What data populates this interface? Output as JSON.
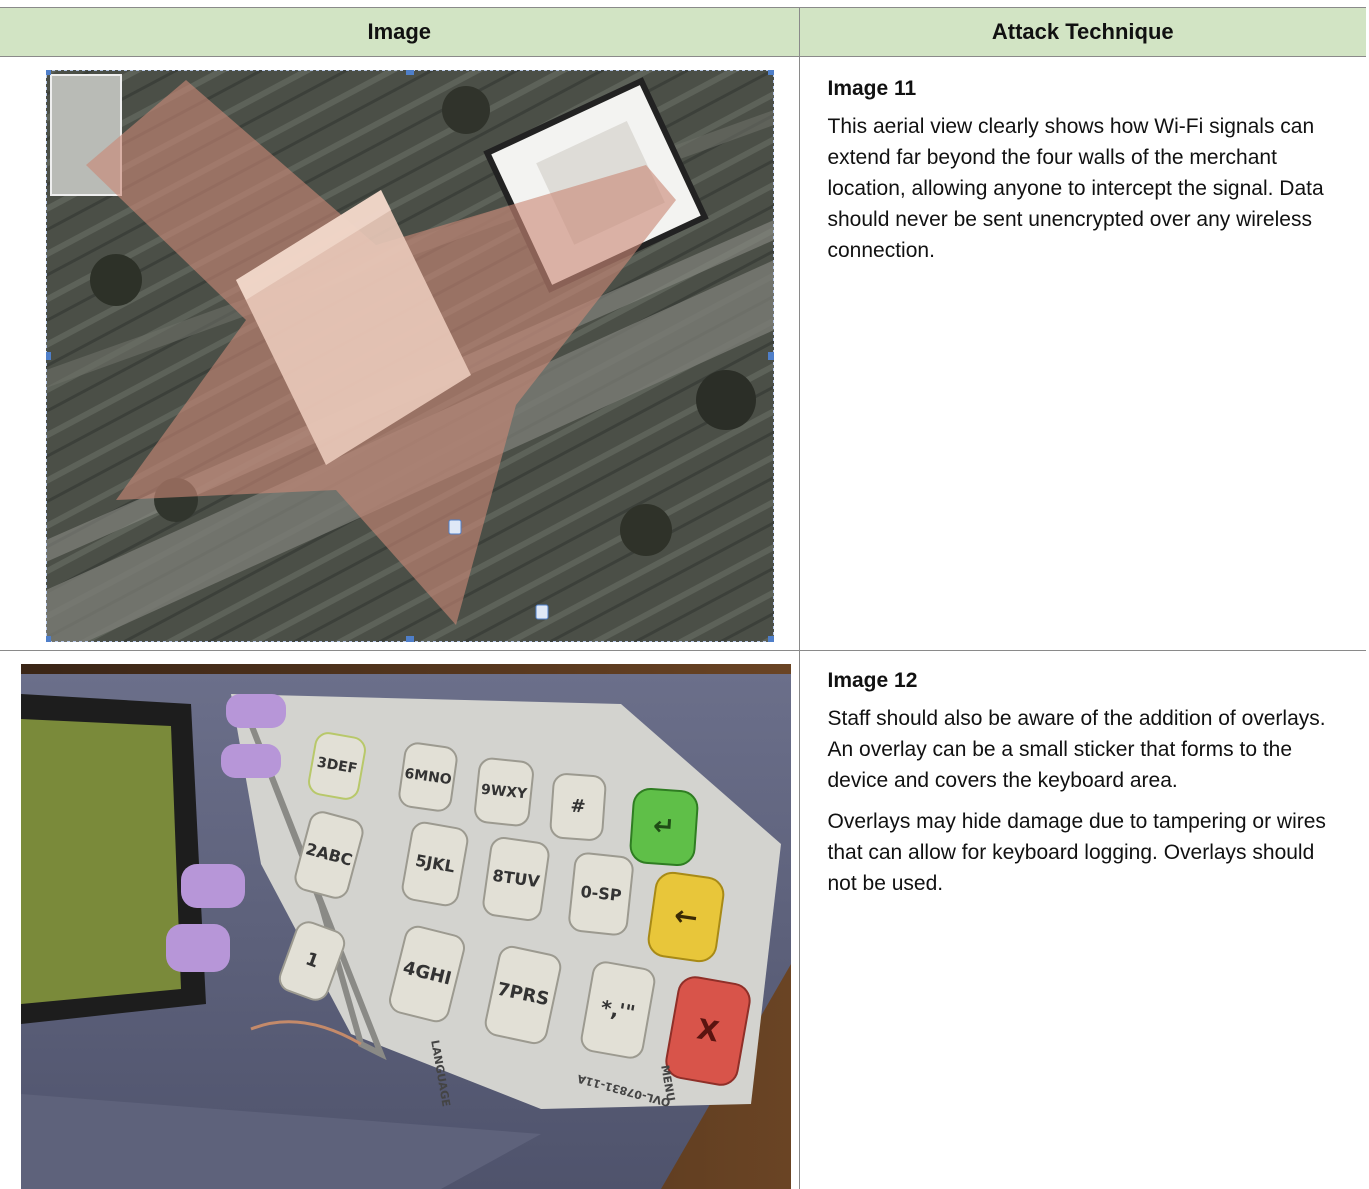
{
  "table": {
    "headers": {
      "image": "Image",
      "technique": "Attack Technique"
    },
    "rows": [
      {
        "title": "Image 11",
        "paragraphs": [
          "This aerial view clearly shows how Wi-Fi signals can extend far beyond the four walls of the merchant location, allowing anyone to intercept the signal. Data should never be sent unencrypted over any wireless connection."
        ]
      },
      {
        "title": "Image 12",
        "paragraphs": [
          "Staff should also be aware of the addition of overlays. An overlay can be a small sticker that forms to the device and covers the keyboard area.",
          "Overlays may hide damage due to tampering or wires that can allow for keyboard logging. Overlays should not be used."
        ]
      }
    ]
  },
  "keypad": {
    "keys": [
      "1",
      "2ABC",
      "3DEF",
      "4GHI",
      "5JKL",
      "6MNO",
      "7PRS",
      "8TUV",
      "9WXY",
      "*,'\"",
      "0-SP",
      "#"
    ],
    "function_keys": [
      "X",
      "←",
      "↵"
    ],
    "labels": {
      "language": "LANGUAGE",
      "menu": "MENU",
      "part_number": "OVL-07831-11A"
    }
  }
}
